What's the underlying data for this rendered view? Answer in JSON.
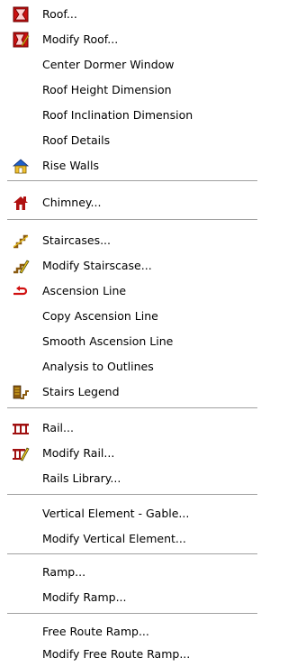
{
  "menu": {
    "items": [
      {
        "label": "Roof...",
        "icon": "roof-icon"
      },
      {
        "label": "Modify Roof...",
        "icon": "modify-roof-icon"
      },
      {
        "label": "Center Dormer Window"
      },
      {
        "label": "Roof Height Dimension"
      },
      {
        "label": "Roof Inclination Dimension"
      },
      {
        "label": "Roof Details"
      },
      {
        "label": "Rise Walls",
        "icon": "rise-walls-icon"
      },
      {
        "label": "Chimney...",
        "icon": "chimney-icon"
      },
      {
        "label": "Staircases...",
        "icon": "staircase-icon"
      },
      {
        "label": "Modify Stairscase...",
        "icon": "modify-staircase-icon"
      },
      {
        "label": "Ascension Line",
        "icon": "ascension-line-icon"
      },
      {
        "label": "Copy Ascension Line"
      },
      {
        "label": "Smooth Ascension Line"
      },
      {
        "label": "Analysis to Outlines"
      },
      {
        "label": "Stairs Legend",
        "icon": "stairs-legend-icon"
      },
      {
        "label": "Rail...",
        "icon": "rail-icon"
      },
      {
        "label": "Modify Rail...",
        "icon": "modify-rail-icon"
      },
      {
        "label": "Rails Library..."
      },
      {
        "label": "Vertical Element - Gable..."
      },
      {
        "label": "Modify Vertical Element..."
      },
      {
        "label": "Ramp..."
      },
      {
        "label": "Modify Ramp..."
      },
      {
        "label": "Free Route Ramp..."
      },
      {
        "label": "Modify Free Route Ramp..."
      }
    ]
  },
  "colors": {
    "separator": "#a0a0a0",
    "icon_red": "#cc1010",
    "icon_brown": "#8a5a10",
    "icon_yellow": "#e8c020"
  }
}
